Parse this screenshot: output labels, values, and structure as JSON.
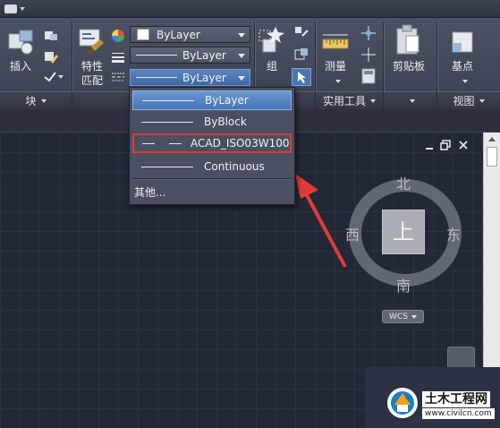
{
  "quick_access": {
    "icon": "app-menu-icon"
  },
  "ribbon": {
    "panels": [
      {
        "id": "block",
        "label": "块"
      },
      {
        "id": "utilities",
        "label": "实用工具"
      },
      {
        "id": "clipboard_panel",
        "label": ""
      },
      {
        "id": "view",
        "label": "视图"
      }
    ],
    "buttons": {
      "insert": "插入",
      "match_properties_line1": "特性",
      "match_properties_line2": "匹配",
      "group": "组",
      "measure": "测量",
      "clipboard": "剪贴板",
      "base_point": "基点"
    },
    "property_combos": {
      "color": "ByLayer",
      "lineweight": "ByLayer",
      "linetype": "ByLayer"
    }
  },
  "linetype_dropdown": {
    "items": [
      {
        "label": "ByLayer",
        "state": "selected"
      },
      {
        "label": "ByBlock",
        "state": "normal"
      },
      {
        "label": "ACAD_ISO03W100",
        "state": "highlighted",
        "dashed": true
      },
      {
        "label": "Continuous",
        "state": "normal"
      }
    ],
    "other_label": "其他..."
  },
  "viewcube": {
    "north": "北",
    "south": "南",
    "east": "东",
    "west": "西",
    "face": "上",
    "wcs_label": "WCS"
  },
  "window_controls": {
    "minimize": "minimize-icon",
    "restore": "restore-icon",
    "close": "close-icon"
  },
  "watermark": {
    "title": "土木工程网",
    "url": "www.civilcn.com"
  },
  "colors": {
    "ribbon_bg": "#434958",
    "canvas_bg": "#222835",
    "selection_blue": "#4f7fbf",
    "highlight_red": "#e23a3a"
  }
}
